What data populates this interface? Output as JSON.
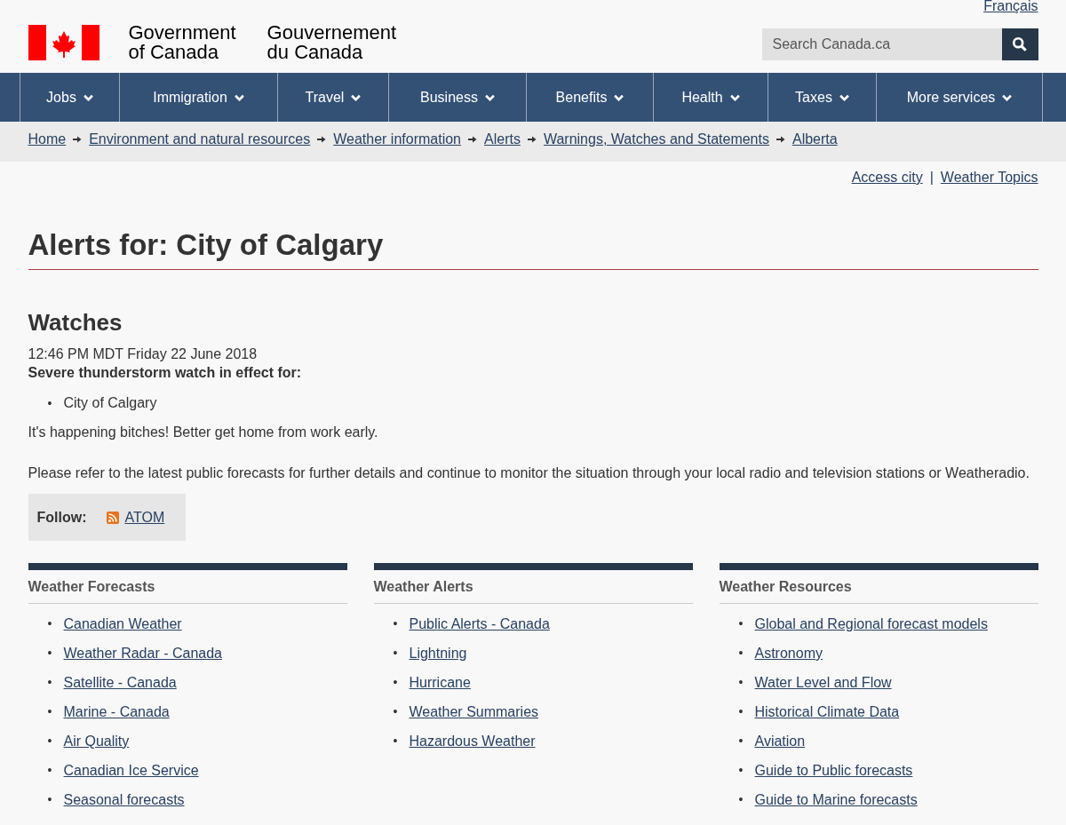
{
  "header": {
    "language_link": "Français",
    "signature_en": [
      "Government",
      "of Canada"
    ],
    "signature_fr": [
      "Gouvernement",
      "du Canada"
    ],
    "search": {
      "placeholder": "Search Canada.ca"
    }
  },
  "menu": [
    {
      "label": "Jobs"
    },
    {
      "label": "Immigration"
    },
    {
      "label": "Travel"
    },
    {
      "label": "Business"
    },
    {
      "label": "Benefits"
    },
    {
      "label": "Health"
    },
    {
      "label": "Taxes"
    },
    {
      "label": "More services"
    }
  ],
  "breadcrumbs": [
    "Home",
    "Environment and natural resources",
    "Weather information",
    "Alerts",
    "Warnings, Watches and Statements",
    "Alberta"
  ],
  "top_links": [
    "Access city",
    "Weather Topics"
  ],
  "top_links_separator": "|",
  "bullet": "•",
  "title": "Alerts for: City of Calgary",
  "alert": {
    "heading": "Watches",
    "issued": "12:46 PM MDT Friday 22 June 2018",
    "lead": "Severe thunderstorm watch in effect for:",
    "regions": [
      "City of Calgary"
    ],
    "paragraphs": [
      "It's happening bitches! Better get home from work early.",
      "Please refer to the latest public forecasts for further details and continue to monitor the situation through your local radio and television stations or Weatheradio."
    ]
  },
  "follow": {
    "label": "Follow:",
    "link": "ATOM"
  },
  "sections": [
    {
      "heading": "Weather Forecasts",
      "links": [
        "Canadian Weather",
        "Weather Radar - Canada",
        "Satellite - Canada",
        "Marine - Canada",
        "Air Quality",
        "Canadian Ice Service",
        "Seasonal forecasts"
      ]
    },
    {
      "heading": "Weather Alerts",
      "links": [
        "Public Alerts - Canada",
        "Lightning",
        "Hurricane",
        "Weather Summaries",
        "Hazardous Weather"
      ]
    },
    {
      "heading": "Weather Resources",
      "links": [
        "Global and Regional forecast models",
        "Astronomy",
        "Water Level and Flow",
        "Historical Climate Data",
        "Aviation",
        "Guide to Public forecasts",
        "Guide to Marine forecasts"
      ]
    }
  ]
}
